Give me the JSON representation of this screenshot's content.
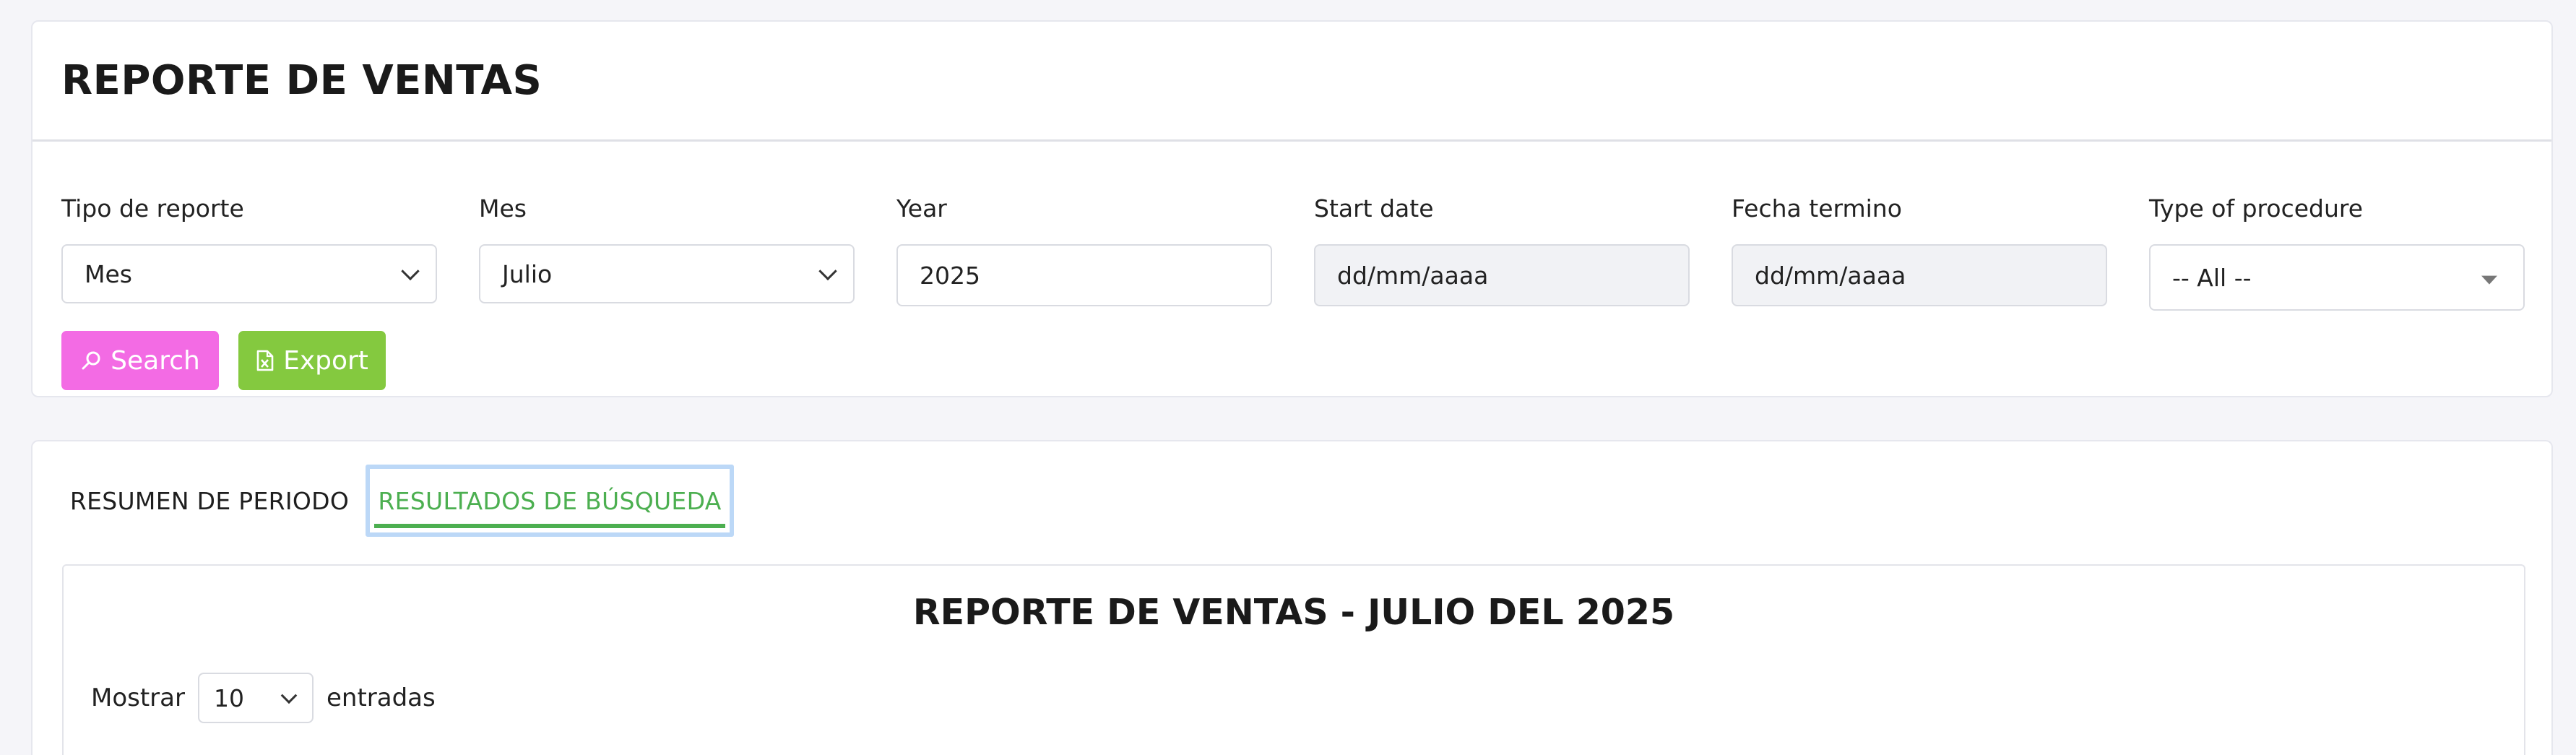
{
  "header": {
    "title": "REPORTE DE VENTAS"
  },
  "filters": {
    "report_type": {
      "label": "Tipo de reporte",
      "value": "Mes"
    },
    "month": {
      "label": "Mes",
      "value": "Julio"
    },
    "year": {
      "label": "Year",
      "value": "2025"
    },
    "start_date": {
      "label": "Start date",
      "value": "dd/mm/aaaa"
    },
    "end_date": {
      "label": "Fecha termino",
      "value": "dd/mm/aaaa"
    },
    "procedure": {
      "label": "Type of procedure",
      "value": "-- All --"
    }
  },
  "actions": {
    "search_label": "Search",
    "export_label": "Export"
  },
  "tabs": [
    {
      "label": "RESUMEN DE PERIODO",
      "active": false
    },
    {
      "label": "RESULTADOS DE BÚSQUEDA",
      "active": true
    }
  ],
  "report": {
    "title": "REPORTE DE VENTAS - JULIO DEL 2025",
    "length_prefix": "Mostrar",
    "length_value": "10",
    "length_suffix": "entradas"
  },
  "colors": {
    "search_button": "#f36be4",
    "export_button": "#84c93f",
    "active_tab": "#4caf50",
    "tab_focus_ring": "#bcd8f7",
    "page_bg": "#f5f5f9"
  },
  "icons": {
    "search": "search-icon",
    "export": "file-excel-icon",
    "dropdown": "chevron-down-icon"
  }
}
